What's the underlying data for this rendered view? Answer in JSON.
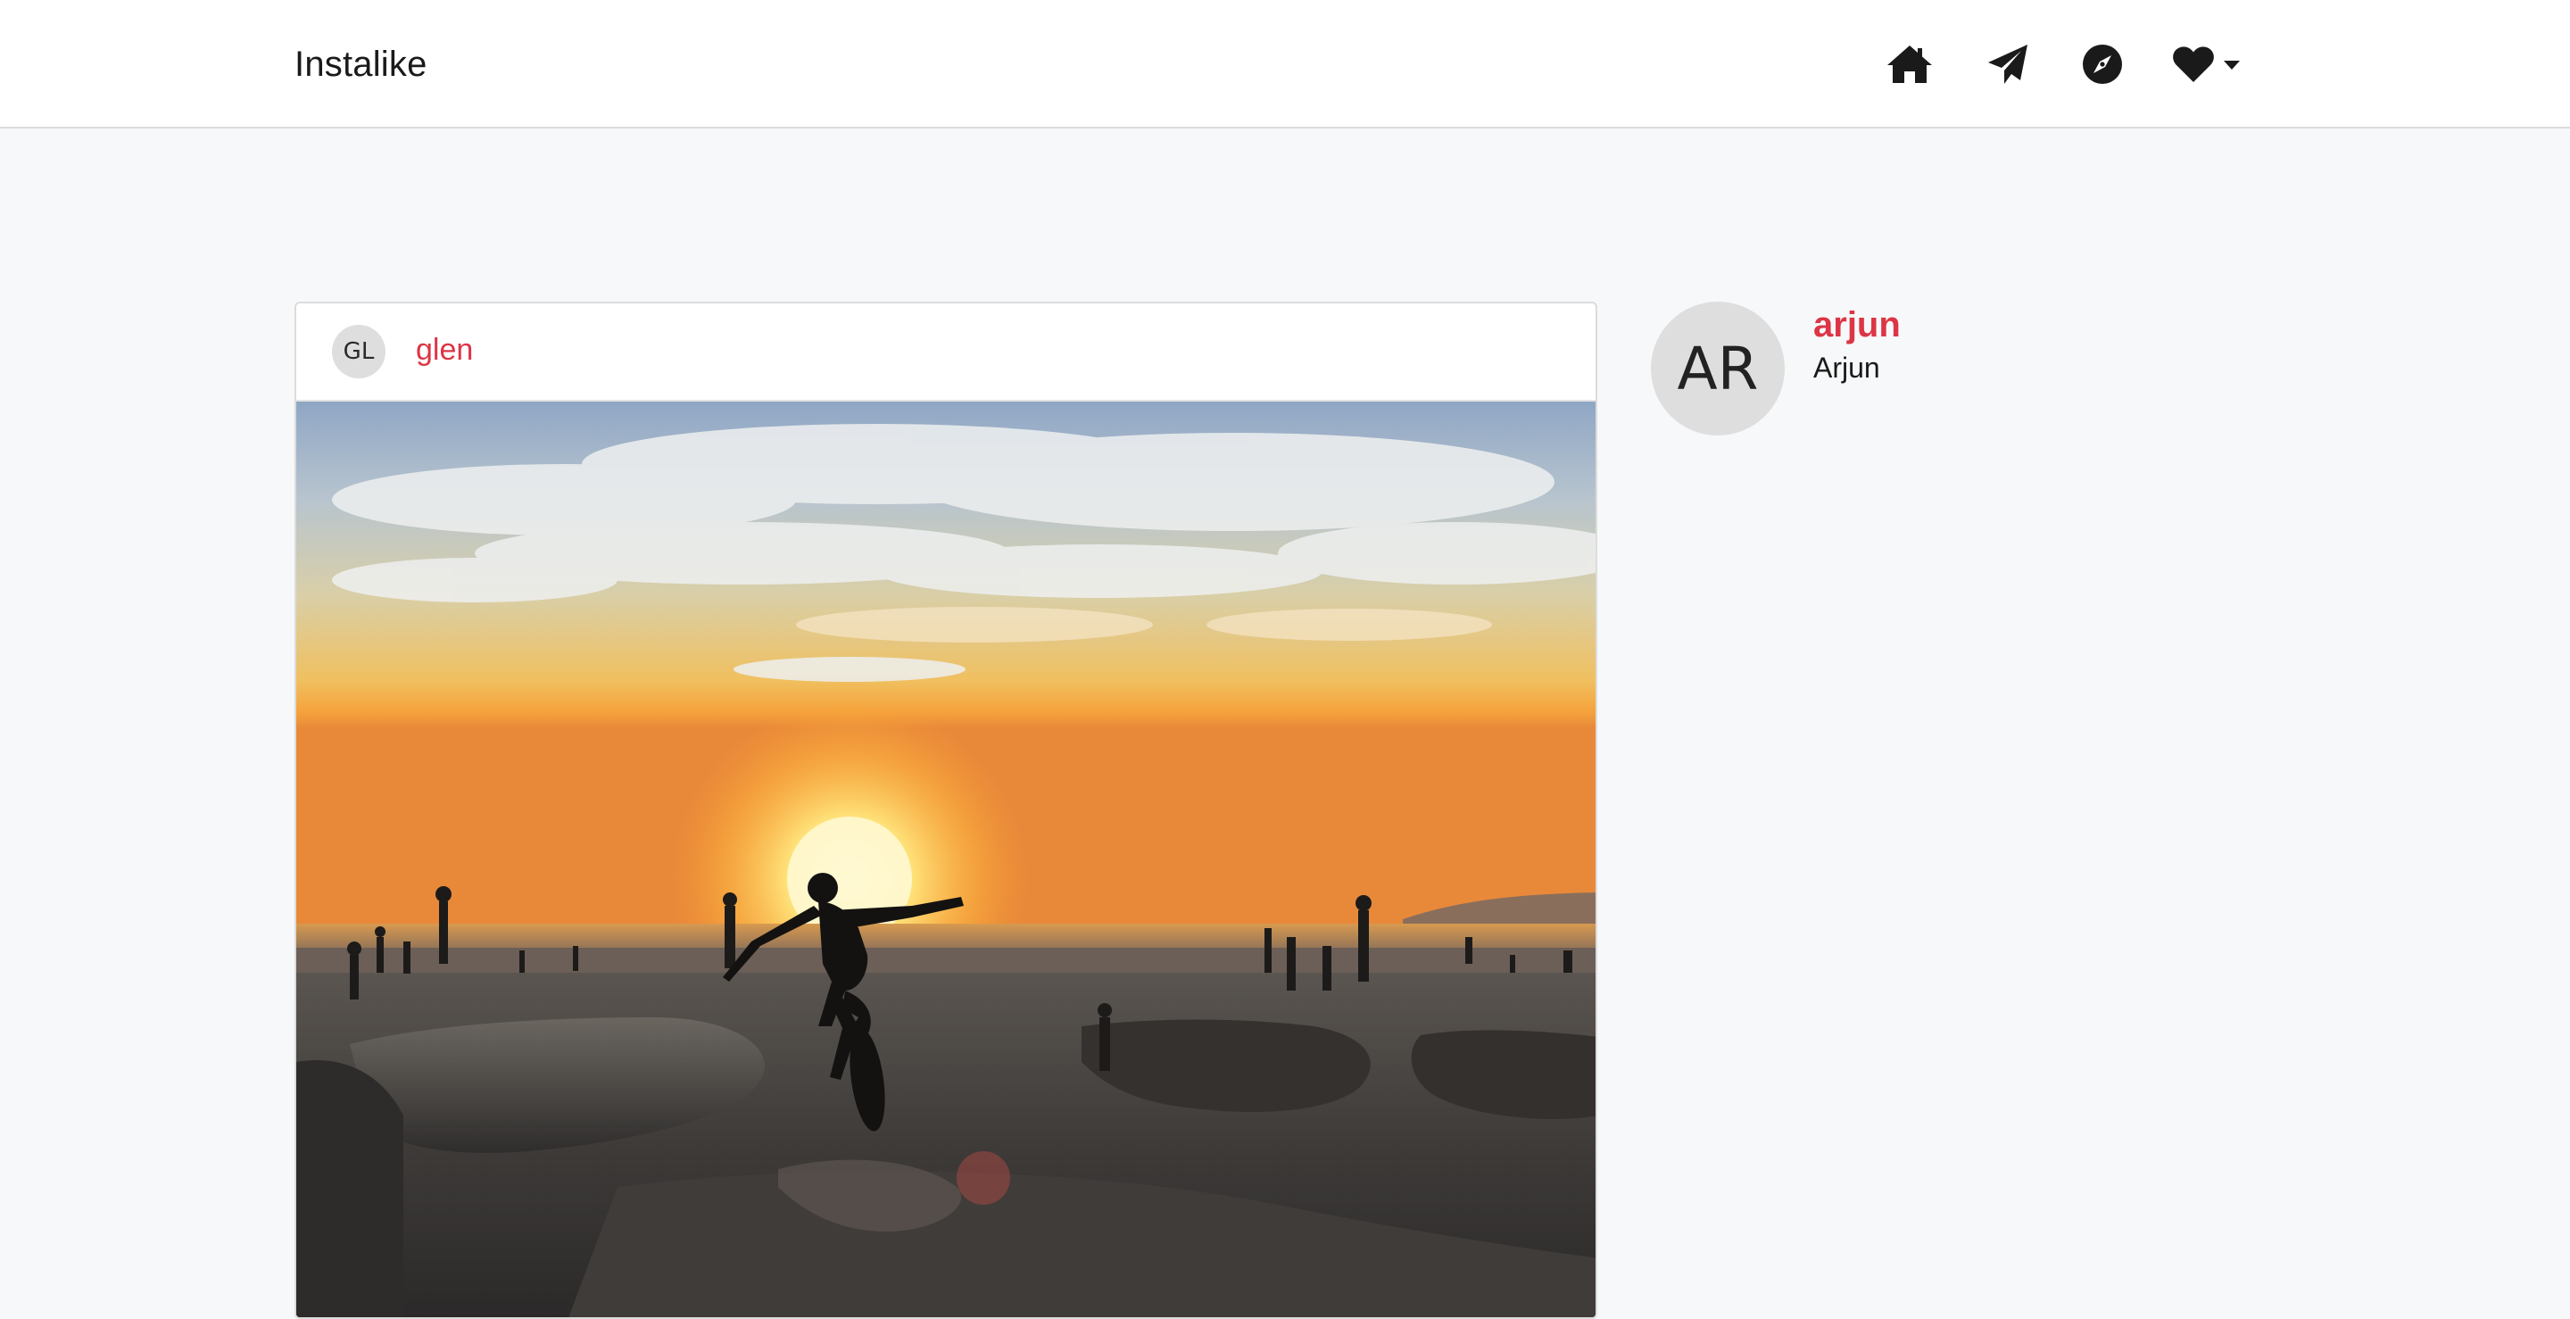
{
  "navbar": {
    "brand": "Instalike",
    "icons": [
      "home-icon",
      "paper-plane-icon",
      "compass-icon",
      "heart-icon"
    ]
  },
  "post": {
    "avatar_initials": "GL",
    "username": "glen",
    "image_subject": "skatepark-sunset"
  },
  "profile": {
    "avatar_initials": "AR",
    "username": "arjun",
    "full_name": "Arjun"
  },
  "colors": {
    "accent": "#dc3545",
    "navbar_bg": "#ffffff",
    "page_bg": "#f7f8fa",
    "avatar_bg": "#dedede"
  }
}
